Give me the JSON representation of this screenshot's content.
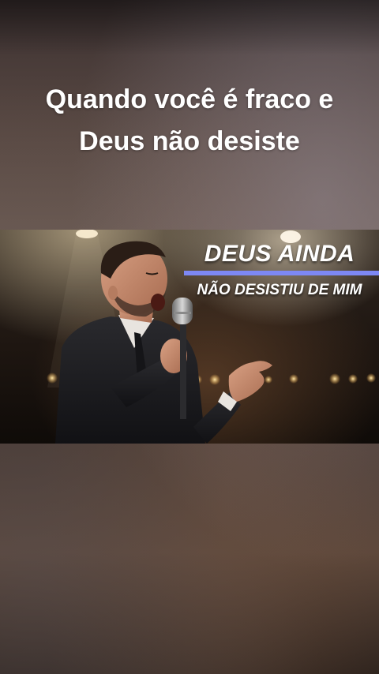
{
  "caption": {
    "line1": "Quando você é fraco e",
    "line2": "Deus não desiste"
  },
  "thumbnail": {
    "title_main": "DEUS AINDA",
    "title_sub": "NÃO DESISTIU DE MIM",
    "accent_color": "#7d88f4"
  }
}
